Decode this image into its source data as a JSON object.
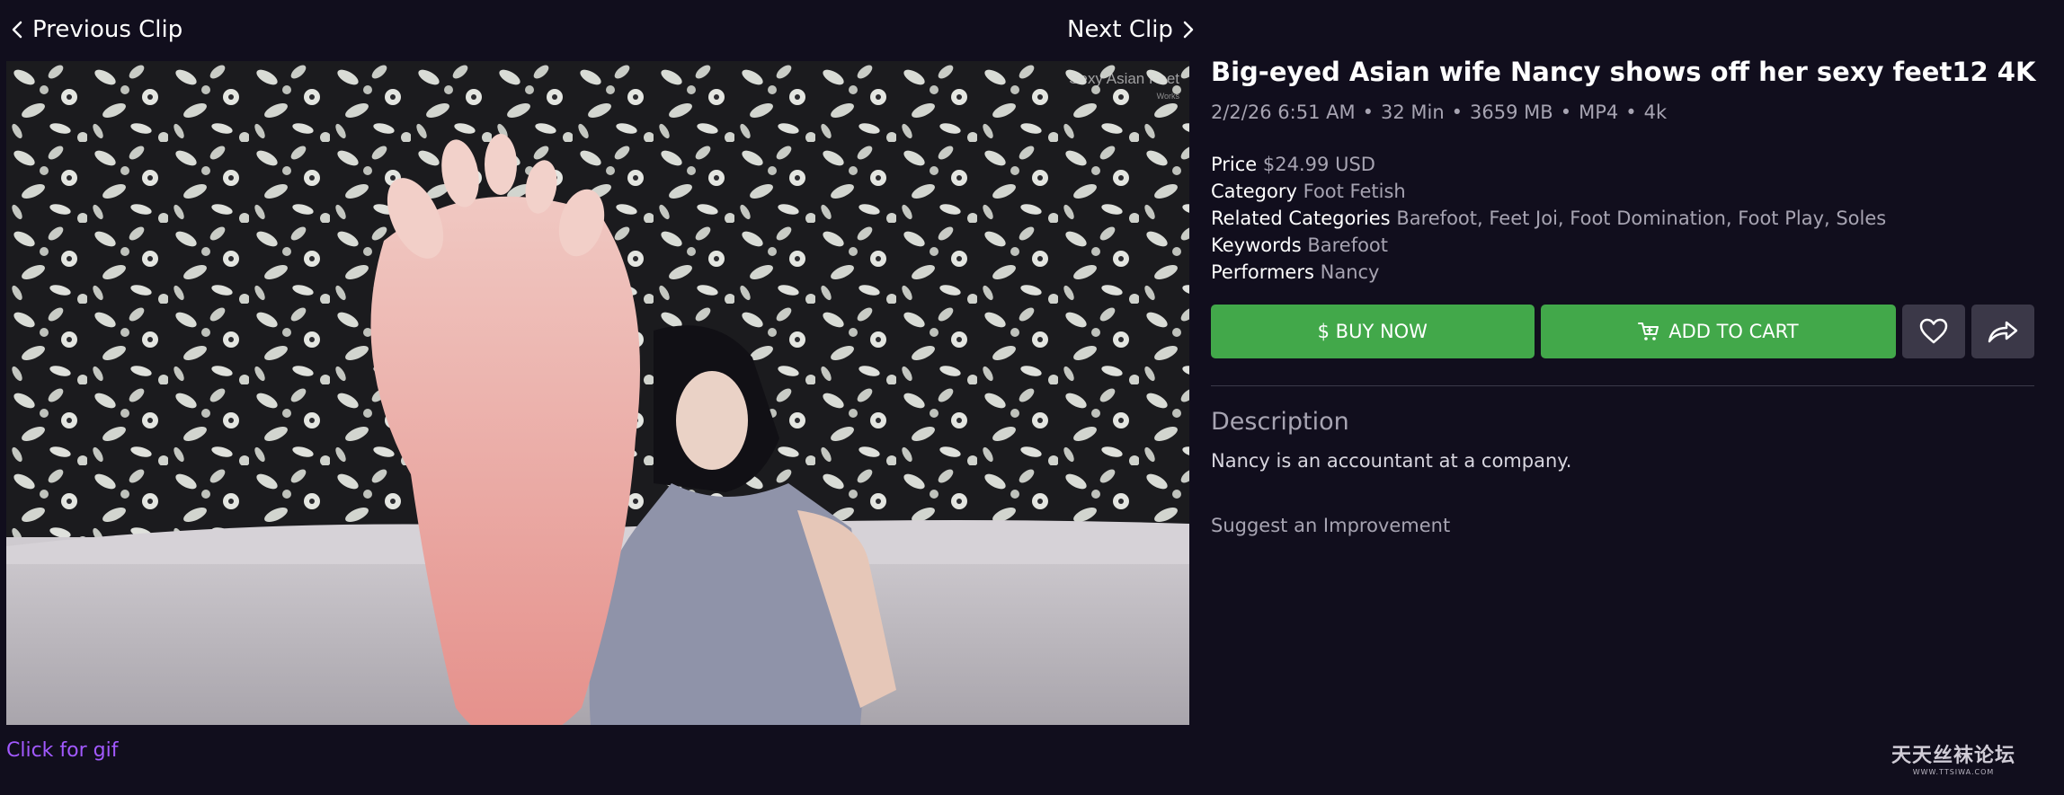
{
  "nav": {
    "previous_label": "Previous Clip",
    "next_label": "Next Clip"
  },
  "preview": {
    "overlay_text": "Sexy Asian Feet",
    "overlay_sub": "Works",
    "gif_link": "Click for gif"
  },
  "clip": {
    "title": "Big-eyed Asian wife Nancy shows off her sexy feet12 4K",
    "meta": {
      "date": "2/2/26 6:51 AM",
      "duration": "32 Min",
      "size": "3659 MB",
      "format": "MP4",
      "resolution": "4k",
      "separator": "•"
    },
    "properties": [
      {
        "key": "Price",
        "value": "$24.99 USD"
      },
      {
        "key": "Category",
        "value": "Foot Fetish"
      },
      {
        "key": "Related Categories",
        "value": "Barefoot, Feet Joi, Foot Domination, Foot Play, Soles"
      },
      {
        "key": "Keywords",
        "value": "Barefoot"
      },
      {
        "key": "Performers",
        "value": "Nancy"
      }
    ]
  },
  "actions": {
    "buy_now": "$ BUY NOW",
    "add_to_cart": "ADD TO CART"
  },
  "description": {
    "heading": "Description",
    "text": "Nancy is an accountant at a company.",
    "suggest": "Suggest an Improvement"
  },
  "watermark": {
    "main": "天天丝袜论坛",
    "sub": "WWW.TTSIWA.COM"
  },
  "colors": {
    "background": "#110e1d",
    "accent_green": "#42a84a",
    "icon_button": "#3b3848",
    "muted_text": "#a7a4b2",
    "link_purple": "#a259ff"
  }
}
